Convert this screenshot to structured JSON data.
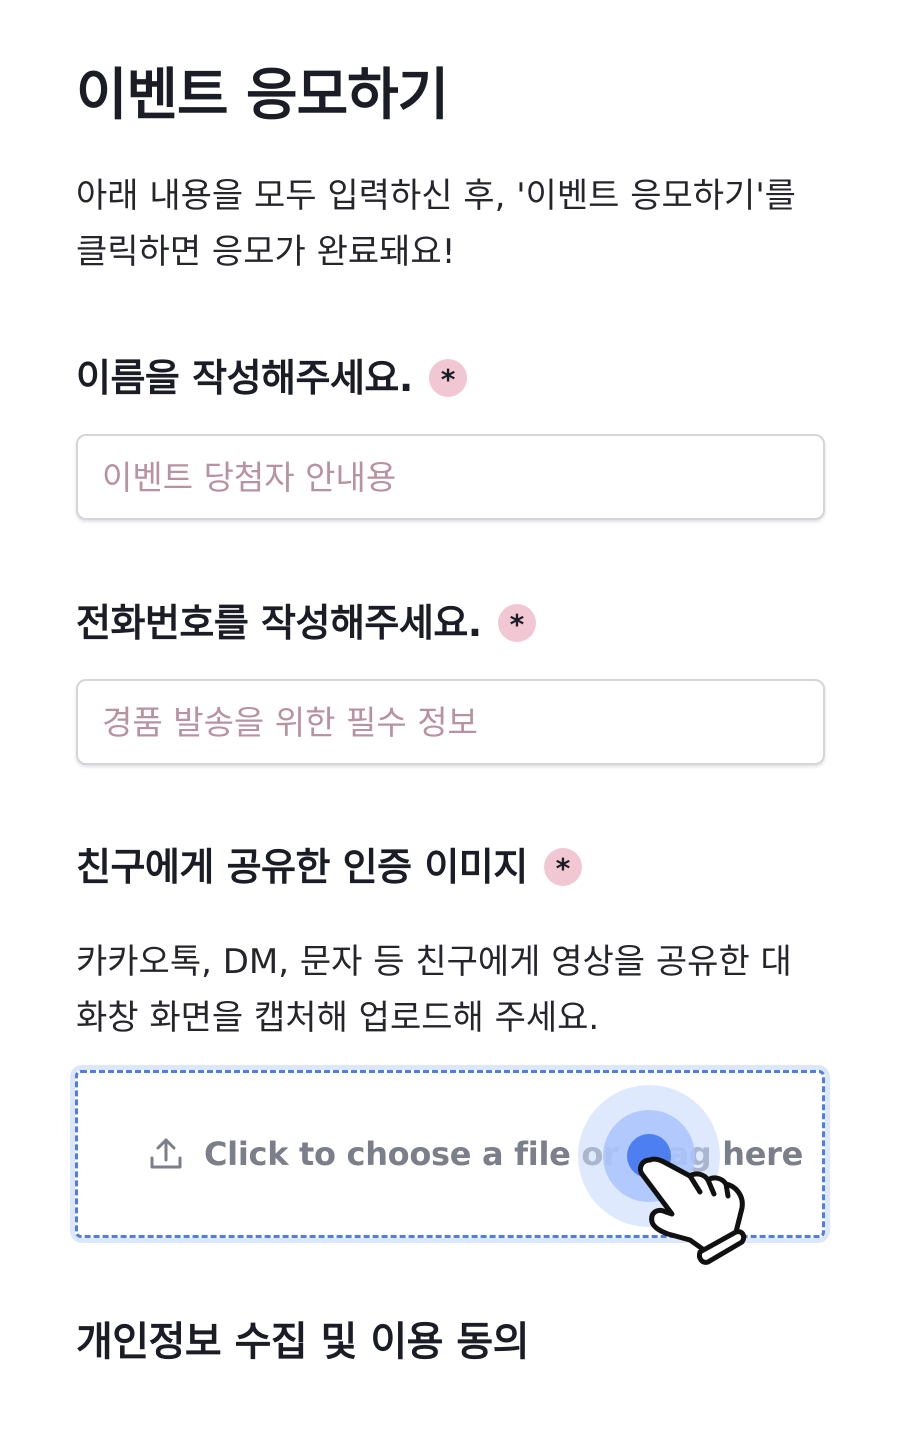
{
  "page": {
    "title": "이벤트 응모하기",
    "intro": "아래 내용을 모두 입력하신 후, '이벤트 응모하기'를 클릭하면 응모가 완료돼요!"
  },
  "fields": {
    "name": {
      "label": "이름을 작성해주세요.",
      "required_mark": "*",
      "placeholder": "이벤트 당첨자 안내용",
      "value": ""
    },
    "phone": {
      "label": "전화번호를 작성해주세요.",
      "required_mark": "*",
      "placeholder": "경품 발송을 위한 필수 정보",
      "value": ""
    },
    "share_image": {
      "label": "친구에게 공유한 인증 이미지",
      "required_mark": "*",
      "help": "카카오톡, DM, 문자 등 친구에게 영상을 공유한 대화창 화면을 캡처해 업로드해 주세요.",
      "dropzone_text": "Click to choose a file or drag here",
      "icon": "upload-icon"
    }
  },
  "consent": {
    "heading": "개인정보 수집 및 이용 동의"
  },
  "colors": {
    "text": "#1b1d26",
    "placeholder": "#b8929f",
    "required_badge": "#f2c7d4",
    "dropzone_accent": "#4f7fe6",
    "dropzone_focus": "#dce7fb"
  }
}
